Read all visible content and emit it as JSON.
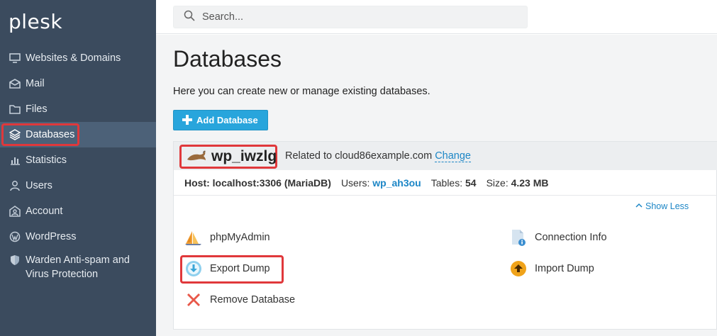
{
  "sidebar": {
    "logo": "plesk",
    "items": [
      {
        "label": "Websites & Domains",
        "icon": "monitor-icon"
      },
      {
        "label": "Mail",
        "icon": "mail-icon"
      },
      {
        "label": "Files",
        "icon": "folder-icon"
      },
      {
        "label": "Databases",
        "icon": "layers-icon",
        "active": true
      },
      {
        "label": "Statistics",
        "icon": "bar-chart-icon"
      },
      {
        "label": "Users",
        "icon": "user-icon"
      },
      {
        "label": "Account",
        "icon": "account-icon"
      },
      {
        "label": "WordPress",
        "icon": "wordpress-icon"
      },
      {
        "label_line1": "Warden Anti-spam and",
        "label_line2": "Virus Protection",
        "icon": "shield-icon"
      }
    ]
  },
  "search": {
    "placeholder": "Search..."
  },
  "main": {
    "title": "Databases",
    "description": "Here you can create new or manage existing databases.",
    "add_button": "Add Database"
  },
  "database": {
    "name": "wp_iwzlg",
    "related_prefix": "Related to cloud86example.com",
    "change_link": "Change",
    "host_label": "Host: localhost:3306 (MariaDB)",
    "users_label": "Users:",
    "users_value": "wp_ah3ou",
    "tables_label": "Tables:",
    "tables_value": "54",
    "size_label": "Size:",
    "size_value": "4.23 MB",
    "show_less": "Show Less",
    "actions": {
      "phpmyadmin": "phpMyAdmin",
      "connection_info": "Connection Info",
      "export_dump": "Export Dump",
      "import_dump": "Import Dump",
      "remove_database": "Remove Database"
    }
  },
  "colors": {
    "sidebar_bg": "#3b4b5e",
    "sidebar_active": "#4c6178",
    "accent_blue": "#28a5dc",
    "link_blue": "#1c86c6",
    "highlight_red": "#e0383b"
  }
}
